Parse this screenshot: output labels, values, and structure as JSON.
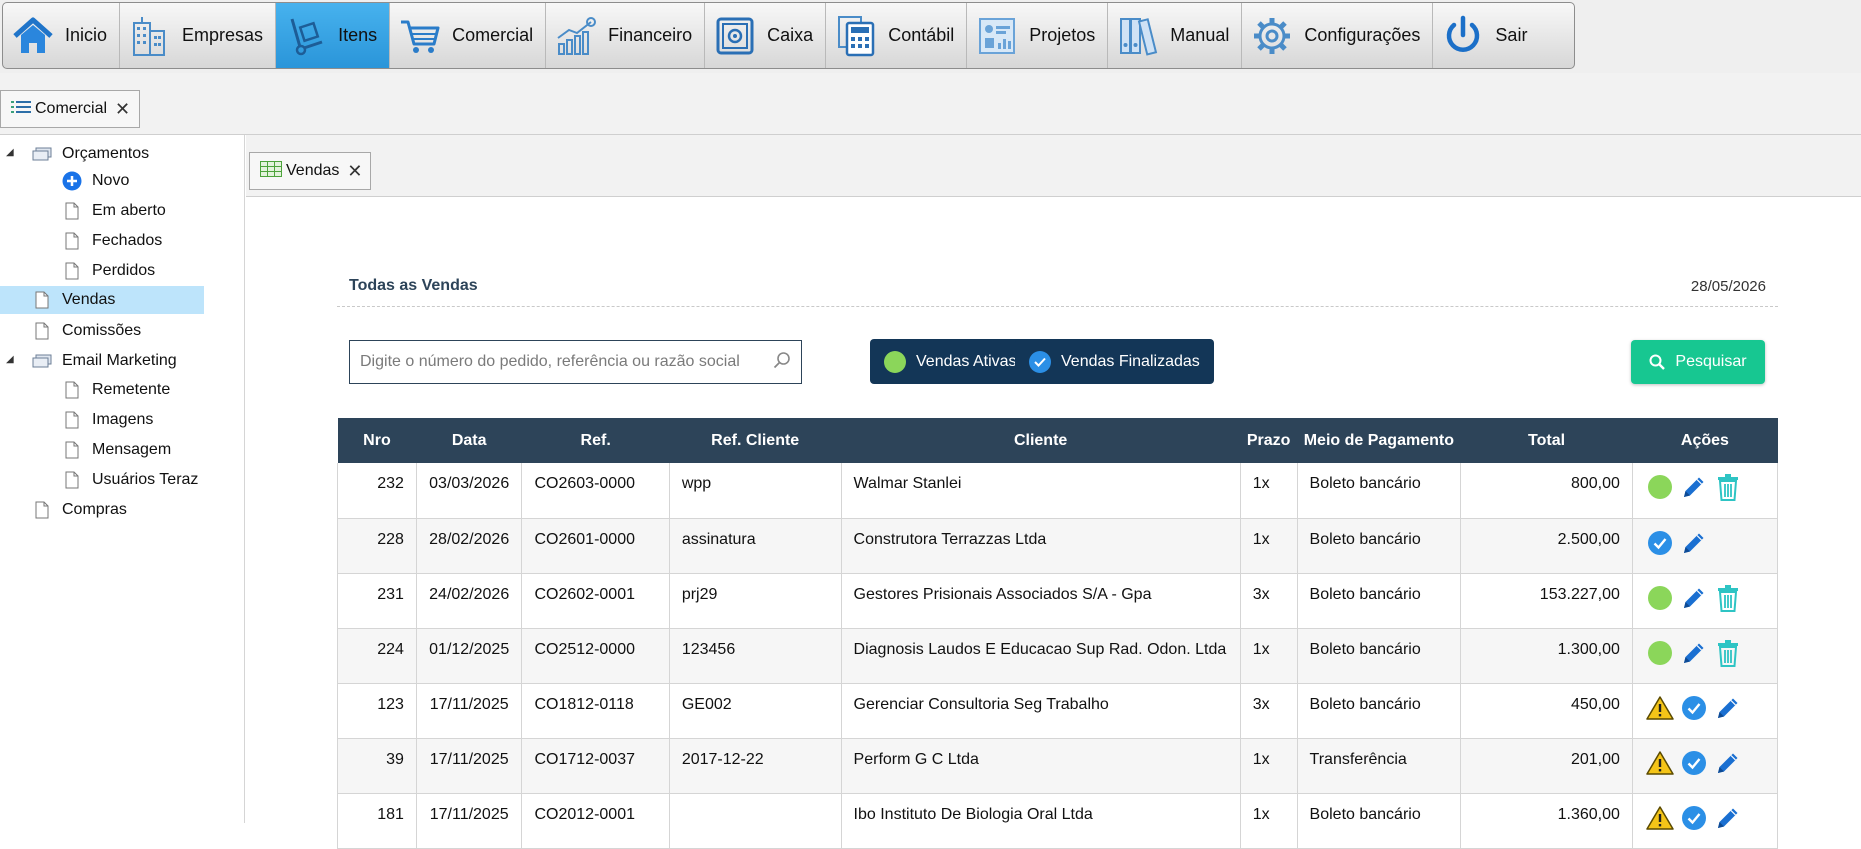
{
  "toolbar": {
    "items": [
      {
        "label": "Inicio",
        "icon": "home-icon"
      },
      {
        "label": "Empresas",
        "icon": "buildings-icon"
      },
      {
        "label": "Itens",
        "icon": "hand-truck-icon"
      },
      {
        "label": "Comercial",
        "icon": "shopping-cart-icon"
      },
      {
        "label": "Financeiro",
        "icon": "chart-growth-icon"
      },
      {
        "label": "Caixa",
        "icon": "safe-icon"
      },
      {
        "label": "Contábil",
        "icon": "calculator-icon"
      },
      {
        "label": "Projetos",
        "icon": "project-board-icon"
      },
      {
        "label": "Manual",
        "icon": "binders-icon"
      },
      {
        "label": "Configurações",
        "icon": "gear-icon"
      },
      {
        "label": "Sair",
        "icon": "power-icon"
      }
    ],
    "active": "Itens"
  },
  "module_tab": {
    "label": "Comercial",
    "close": "✕"
  },
  "tree": {
    "orcamentos": "Orçamentos",
    "novo": "Novo",
    "em_aberto": "Em aberto",
    "fechados": "Fechados",
    "perdidos": "Perdidos",
    "vendas": "Vendas",
    "comissoes": "Comissões",
    "email_marketing": "Email Marketing",
    "remetente": "Remetente",
    "imagens": "Imagens",
    "mensagem": "Mensagem",
    "usuarios_teraz": "Usuários Teraz",
    "compras": "Compras"
  },
  "content_tab": {
    "label": "Vendas",
    "close": "✕"
  },
  "panel": {
    "title": "Todas as Vendas",
    "date": "28/05/2026",
    "search_placeholder": "Digite o número do pedido, referência ou razão social",
    "filter_active": "Vendas Ativas",
    "filter_finished": "Vendas Finalizadas",
    "search_button": "Pesquisar"
  },
  "colors": {
    "header_dark": "#2d4459",
    "filter_button": "#133657",
    "search_button": "#17c791",
    "active_dot": "#8bd65a",
    "check_blue": "#2b8fe6",
    "toolbar_active": "#3aa7e8"
  },
  "table": {
    "headers": [
      "Nro",
      "Data",
      "Ref.",
      "Ref. Cliente",
      "Cliente",
      "Prazo",
      "Meio de Pagamento",
      "Total",
      "Ações"
    ],
    "rows": [
      {
        "nro": "232",
        "data": "03/03/2026",
        "ref": "CO2603-0000",
        "ref_cliente": "wpp",
        "cliente": "Walmar Stanlei",
        "prazo": "1x",
        "pagamento": "Boleto bancário",
        "total": "800,00",
        "actions": [
          "active-dot-icon",
          "pencil-icon",
          "trash-icon"
        ]
      },
      {
        "nro": "228",
        "data": "28/02/2026",
        "ref": "CO2601-0000",
        "ref_cliente": "assinatura",
        "cliente": "Construtora Terrazzas Ltda",
        "prazo": "1x",
        "pagamento": "Boleto bancário",
        "total": "2.500,00",
        "actions": [
          "check-circle-icon",
          "pencil-icon"
        ]
      },
      {
        "nro": "231",
        "data": "24/02/2026",
        "ref": "CO2602-0001",
        "ref_cliente": "prj29",
        "cliente": "Gestores Prisionais Associados S/A - Gpa",
        "prazo": "3x",
        "pagamento": "Boleto bancário",
        "total": "153.227,00",
        "actions": [
          "active-dot-icon",
          "pencil-icon",
          "trash-icon"
        ]
      },
      {
        "nro": "224",
        "data": "01/12/2025",
        "ref": "CO2512-0000",
        "ref_cliente": "123456",
        "cliente": "Diagnosis Laudos E Educacao Sup Rad. Odon. Ltda",
        "prazo": "1x",
        "pagamento": "Boleto bancário",
        "total": "1.300,00",
        "actions": [
          "active-dot-icon",
          "pencil-icon",
          "trash-icon"
        ]
      },
      {
        "nro": "123",
        "data": "17/11/2025",
        "ref": "CO1812-0118",
        "ref_cliente": "GE002",
        "cliente": "Gerenciar Consultoria Seg Trabalho",
        "prazo": "3x",
        "pagamento": "Boleto bancário",
        "total": "450,00",
        "actions": [
          "warning-icon",
          "check-circle-icon",
          "pencil-icon"
        ]
      },
      {
        "nro": "39",
        "data": "17/11/2025",
        "ref": "CO1712-0037",
        "ref_cliente": "2017-12-22",
        "cliente": "Perform G C Ltda",
        "prazo": "1x",
        "pagamento": "Transferência",
        "total": "201,00",
        "actions": [
          "warning-icon",
          "check-circle-icon",
          "pencil-icon"
        ]
      },
      {
        "nro": "181",
        "data": "17/11/2025",
        "ref": "CO2012-0001",
        "ref_cliente": "",
        "cliente": "Ibo Instituto De Biologia Oral Ltda",
        "prazo": "1x",
        "pagamento": "Boleto bancário",
        "total": "1.360,00",
        "actions": [
          "warning-icon",
          "check-circle-icon",
          "pencil-icon"
        ]
      }
    ]
  }
}
